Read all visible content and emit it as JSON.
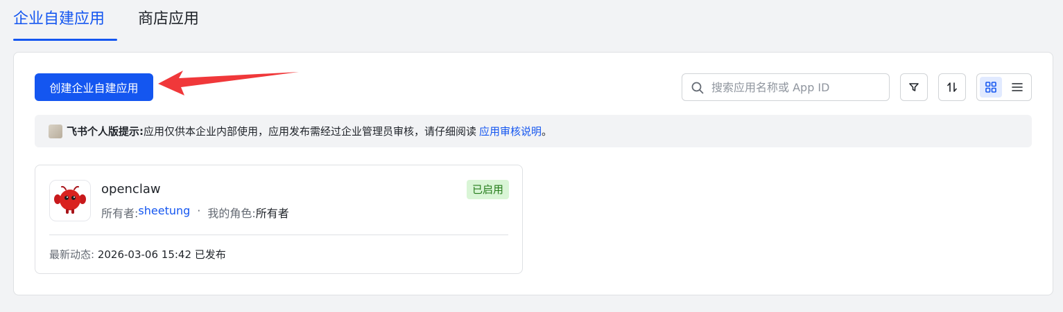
{
  "tabs": [
    {
      "label": "企业自建应用",
      "active": true
    },
    {
      "label": "商店应用",
      "active": false
    }
  ],
  "toolbar": {
    "create_label": "创建企业自建应用",
    "search_placeholder": "搜索应用名称或 App ID",
    "filter_icon": "filter-icon",
    "sort_icon": "sort-icon",
    "grid_icon": "grid-view-icon",
    "list_icon": "list-view-icon"
  },
  "notice": {
    "prefix": "飞书个人版提示:",
    "text": "应用仅供本企业内部使用，应用发布需经过企业管理员审核，请仔细阅读",
    "link": "应用审核说明",
    "suffix": "。"
  },
  "apps": [
    {
      "name": "openclaw",
      "owner_label": "所有者:",
      "owner": "sheetung",
      "separator": "·",
      "role_label": "我的角色:",
      "role": "所有者",
      "status": "已启用",
      "activity_label": "最新动态:",
      "activity": "2026-03-06 15:42 已发布"
    }
  ],
  "colors": {
    "accent": "#1456f0",
    "status_bg": "#d9f5d6",
    "status_fg": "#237b19",
    "annotation_arrow": "#f0383a"
  }
}
